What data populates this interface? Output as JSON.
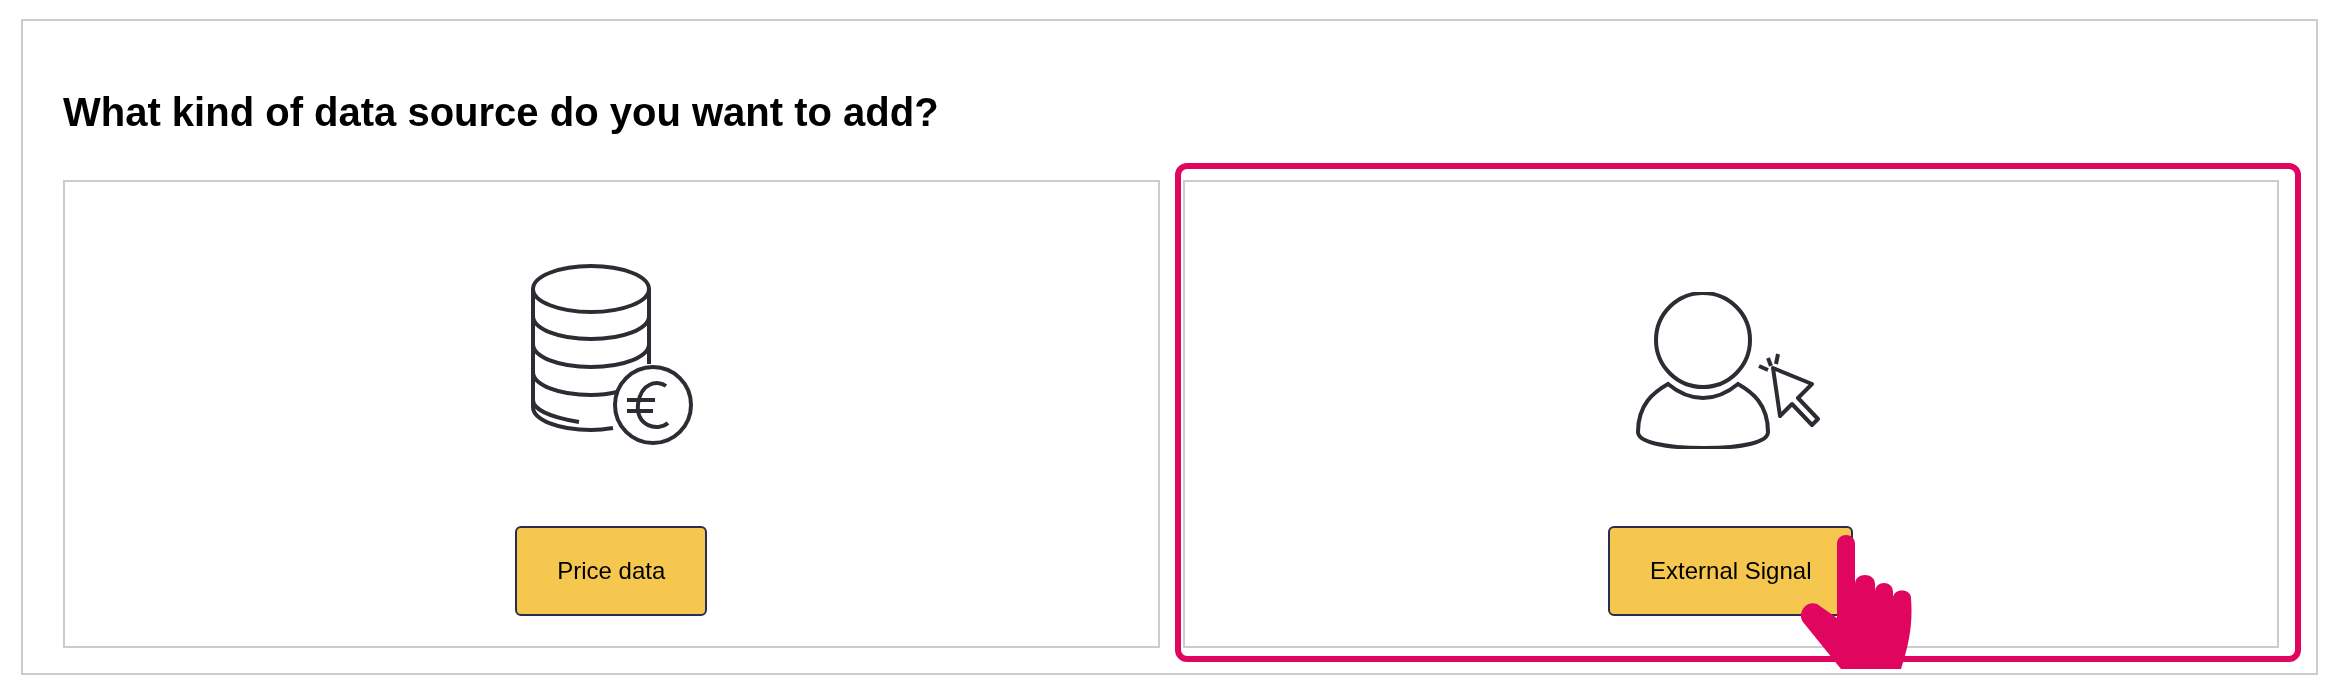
{
  "heading": "What kind of data source do you want to add?",
  "cards": [
    {
      "kind": "price",
      "label": "Price data",
      "selected": false
    },
    {
      "kind": "signal",
      "label": "External Signal",
      "selected": true
    }
  ]
}
